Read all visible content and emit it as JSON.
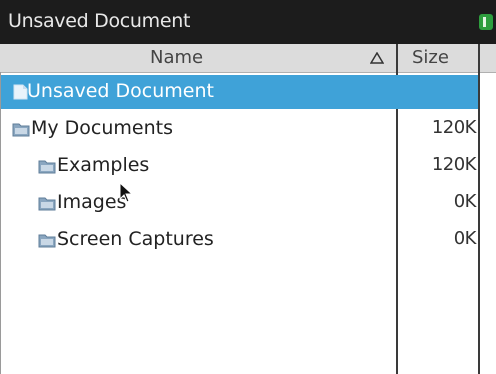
{
  "window": {
    "title": "Unsaved Document"
  },
  "columns": {
    "name": "Name",
    "size": "Size"
  },
  "rows": [
    {
      "name": "Unsaved Document",
      "size": "",
      "icon": "document-icon",
      "selected": true
    },
    {
      "name": "My Documents",
      "size": "120K",
      "icon": "folder-icon"
    },
    {
      "name": "Examples",
      "size": "120K",
      "icon": "folder-icon"
    },
    {
      "name": "Images",
      "size": "0K",
      "icon": "folder-icon"
    },
    {
      "name": "Screen Captures",
      "size": "0K",
      "icon": "folder-icon"
    }
  ],
  "colors": {
    "selection": "#3fa2d8",
    "titlebar": "#1c1c1c",
    "header": "#dcdcdc",
    "folder": "#8aa6c0"
  }
}
